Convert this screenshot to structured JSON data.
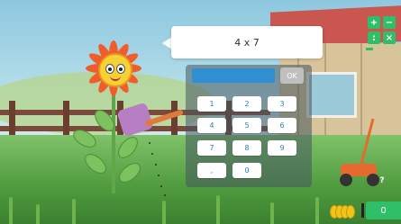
{
  "question": {
    "text": "4 x 7"
  },
  "answer": {
    "value": ""
  },
  "ok_button": {
    "label": "OK"
  },
  "keypad": {
    "keys": [
      "1",
      "2",
      "3",
      "4",
      "5",
      "6",
      "7",
      "8",
      "9",
      ",",
      "0"
    ]
  },
  "operations": {
    "plus": "+",
    "minus": "−",
    "divide": ":",
    "multiply": "×"
  },
  "help": {
    "label": "?"
  },
  "score": {
    "value": "0"
  },
  "colors": {
    "accent_green": "#2fbf69",
    "answer_blue": "#2f8fd1",
    "key_text": "#2a7fc0"
  }
}
